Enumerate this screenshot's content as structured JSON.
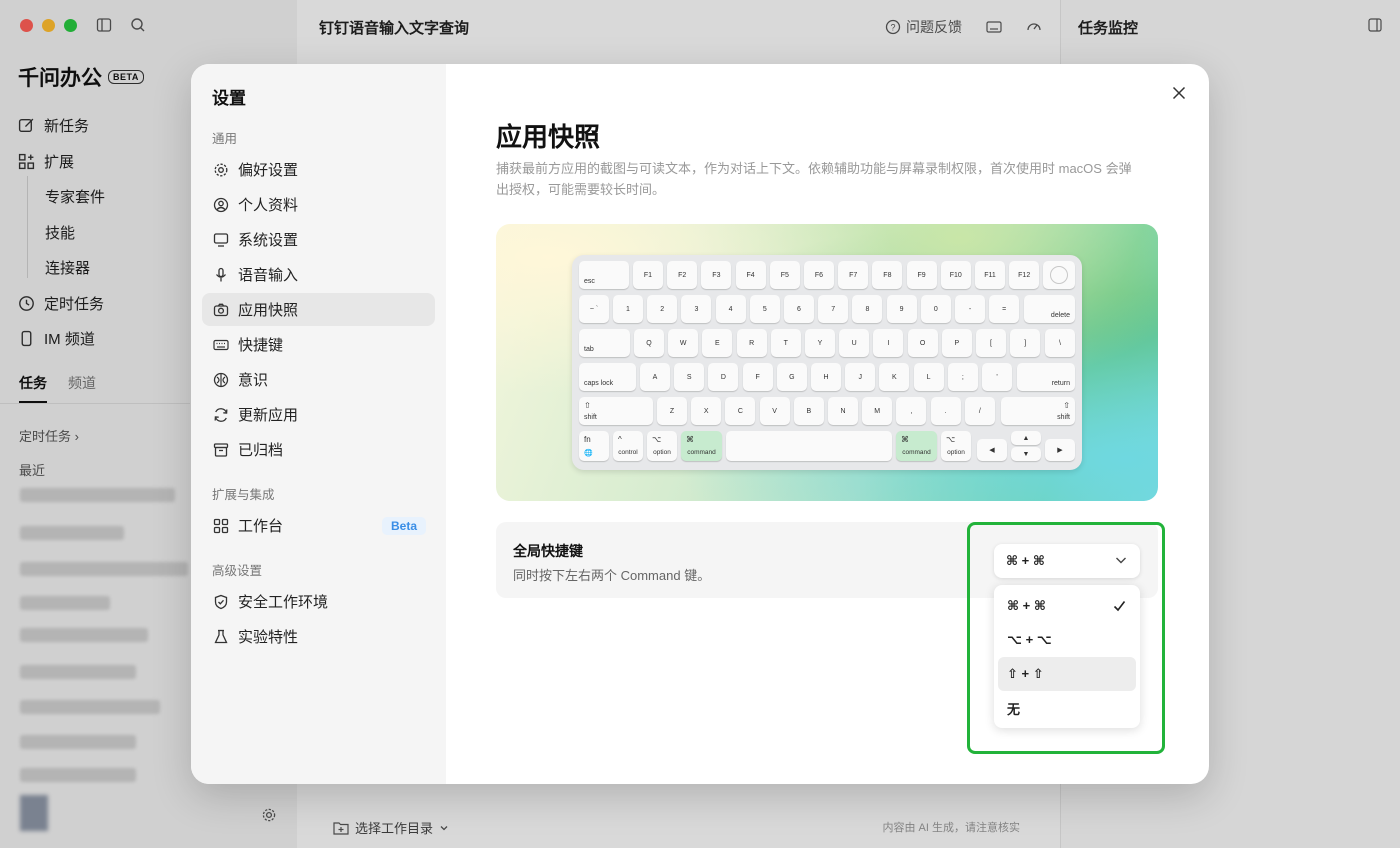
{
  "app": {
    "brand": "千问办公",
    "brand_badge": "BETA",
    "nav": [
      {
        "label": "新任务",
        "icon": "edit-icon"
      },
      {
        "label": "扩展",
        "icon": "grid-plus-icon"
      },
      {
        "label": "专家套件",
        "sub": true
      },
      {
        "label": "技能",
        "sub": true
      },
      {
        "label": "连接器",
        "sub": true
      },
      {
        "label": "定时任务",
        "icon": "clock-icon"
      },
      {
        "label": "IM 频道",
        "icon": "phone-icon"
      }
    ],
    "tabs": {
      "tasks": "任务",
      "channels": "频道"
    },
    "scheduled": "定时任务 ›",
    "recent": "最近",
    "center_title": "钉钉语音输入文字查询",
    "feedback": "问题反馈",
    "work_dir": "选择工作目录",
    "ai_notice": "内容由 AI 生成，请注意核实",
    "right_title": "任务监控"
  },
  "settings": {
    "title": "设置",
    "groups": {
      "general": "通用",
      "extensions": "扩展与集成",
      "advanced": "高级设置"
    },
    "items": [
      {
        "label": "偏好设置"
      },
      {
        "label": "个人资料"
      },
      {
        "label": "系统设置"
      },
      {
        "label": "语音输入"
      },
      {
        "label": "应用快照"
      },
      {
        "label": "快捷键"
      },
      {
        "label": "意识"
      },
      {
        "label": "更新应用"
      },
      {
        "label": "已归档"
      },
      {
        "label": "工作台",
        "badge": "Beta"
      },
      {
        "label": "安全工作环境"
      },
      {
        "label": "实验特性"
      }
    ],
    "active_item": "应用快照"
  },
  "snapshot": {
    "title": "应用快照",
    "description": "捕获最前方应用的截图与可读文本，作为对话上下文。依赖辅助功能与屏幕录制权限，首次使用时 macOS 会弹出授权，可能需要较长时间。",
    "keyboard": {
      "row0": [
        "esc",
        "F1",
        "F2",
        "F3",
        "F4",
        "F5",
        "F6",
        "F7",
        "F8",
        "F9",
        "F10",
        "F11",
        "F12"
      ],
      "row1": [
        "~\n`",
        "1",
        "2",
        "3",
        "4",
        "5",
        "6",
        "7",
        "8",
        "9",
        "0",
        "-",
        "=",
        "delete"
      ],
      "row2": [
        "tab",
        "Q",
        "W",
        "E",
        "R",
        "T",
        "Y",
        "U",
        "I",
        "O",
        "P",
        "[",
        "]",
        "\\"
      ],
      "row3": [
        "caps lock",
        "A",
        "S",
        "D",
        "F",
        "G",
        "H",
        "J",
        "K",
        "L",
        ";",
        "'",
        "return"
      ],
      "row4": [
        "shift",
        "Z",
        "X",
        "C",
        "V",
        "B",
        "N",
        "M",
        ",",
        ".",
        "/",
        "shift"
      ],
      "mods": {
        "fn": "fn",
        "globe": "🌐",
        "control": "control",
        "option": "option",
        "command": "command",
        "ctrl_sym": "^",
        "opt_sym": "⌥",
        "cmd_sym": "⌘",
        "shift_sym": "⇧",
        "left": "◀",
        "right": "▶",
        "up": "▲",
        "down": "▼"
      }
    },
    "shortcut": {
      "title": "全局快捷键",
      "description": "同时按下左右两个 Command 键。",
      "selected": "⌘ + ⌘",
      "options": [
        "⌘ + ⌘",
        "⌥ + ⌥",
        "⇧ + ⇧",
        "无"
      ],
      "hover_option": "⇧ + ⇧"
    }
  },
  "colors": {
    "accent": "#3a8ee6",
    "highlight_frame": "#22b33a",
    "key_highlight": "#c7ebcf"
  }
}
